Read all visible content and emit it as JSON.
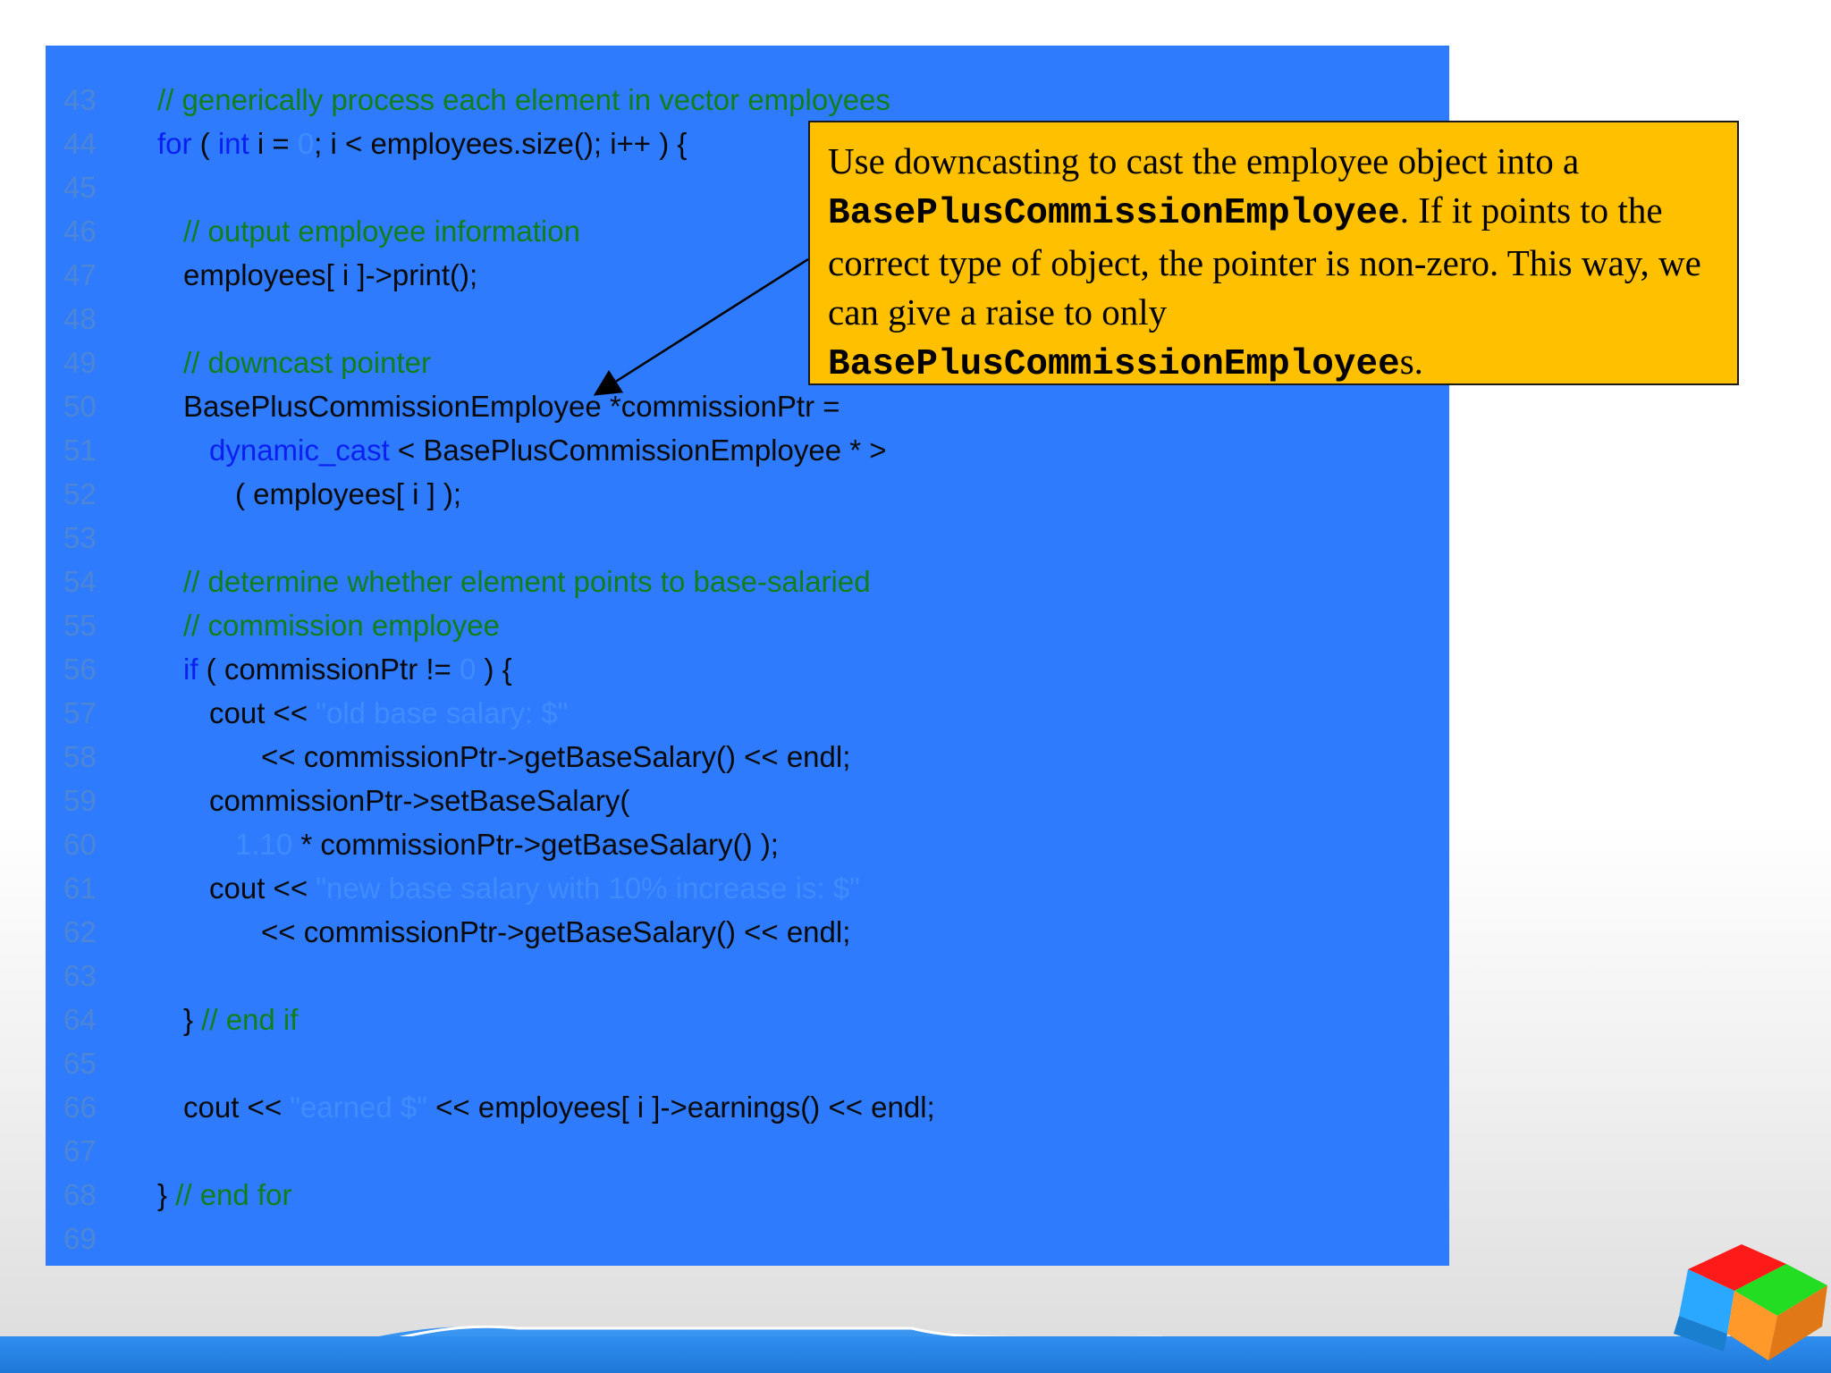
{
  "code": {
    "lines": [
      {
        "n": "43",
        "indent": 0,
        "parts": [
          {
            "t": "// generically process each element in vector employees",
            "c": "cm"
          }
        ]
      },
      {
        "n": "44",
        "indent": 0,
        "parts": [
          {
            "t": "for",
            "c": "kw"
          },
          {
            "t": " ( ",
            "c": ""
          },
          {
            "t": "int",
            "c": "kw"
          },
          {
            "t": " i = ",
            "c": ""
          },
          {
            "t": "0",
            "c": "lit"
          },
          {
            "t": "; i < employees.size(); i++ ) {",
            "c": ""
          }
        ]
      },
      {
        "n": "45",
        "indent": 0,
        "parts": []
      },
      {
        "n": "46",
        "indent": 1,
        "parts": [
          {
            "t": "// output employee information",
            "c": "cm"
          }
        ]
      },
      {
        "n": "47",
        "indent": 1,
        "parts": [
          {
            "t": "employees[ i ]->print();",
            "c": ""
          }
        ]
      },
      {
        "n": "48",
        "indent": 0,
        "parts": []
      },
      {
        "n": "49",
        "indent": 1,
        "parts": [
          {
            "t": "// downcast pointer",
            "c": "cm"
          }
        ]
      },
      {
        "n": "50",
        "indent": 1,
        "parts": [
          {
            "t": "BasePlusCommissionEmployee *commissionPtr =",
            "c": ""
          }
        ]
      },
      {
        "n": "51",
        "indent": 2,
        "parts": [
          {
            "t": "dynamic_cast",
            "c": "kw"
          },
          {
            "t": " < BasePlusCommissionEmployee * >",
            "c": ""
          }
        ]
      },
      {
        "n": "52",
        "indent": 3,
        "parts": [
          {
            "t": "( employees[ i ] );",
            "c": ""
          }
        ]
      },
      {
        "n": "53",
        "indent": 0,
        "parts": []
      },
      {
        "n": "54",
        "indent": 1,
        "parts": [
          {
            "t": "// determine whether element points to base-salaried",
            "c": "cm"
          }
        ]
      },
      {
        "n": "55",
        "indent": 1,
        "parts": [
          {
            "t": "// commission employee",
            "c": "cm"
          }
        ]
      },
      {
        "n": "56",
        "indent": 1,
        "parts": [
          {
            "t": "if",
            "c": "kw"
          },
          {
            "t": " ( commissionPtr != ",
            "c": ""
          },
          {
            "t": "0",
            "c": "lit"
          },
          {
            "t": " ) {",
            "c": ""
          }
        ]
      },
      {
        "n": "57",
        "indent": 2,
        "parts": [
          {
            "t": "cout << ",
            "c": ""
          },
          {
            "t": "\"old base salary: $\"",
            "c": "lit"
          }
        ]
      },
      {
        "n": "58",
        "indent": 4,
        "parts": [
          {
            "t": "<< commissionPtr->getBaseSalary() << endl;",
            "c": ""
          }
        ]
      },
      {
        "n": "59",
        "indent": 2,
        "parts": [
          {
            "t": "commissionPtr->setBaseSalary(",
            "c": ""
          }
        ]
      },
      {
        "n": "60",
        "indent": 3,
        "parts": [
          {
            "t": "1.10",
            "c": "lit"
          },
          {
            "t": " * commissionPtr->getBaseSalary() );",
            "c": ""
          }
        ]
      },
      {
        "n": "61",
        "indent": 2,
        "parts": [
          {
            "t": "cout << ",
            "c": ""
          },
          {
            "t": "\"new base salary with 10% increase is: $\"",
            "c": "lit"
          }
        ]
      },
      {
        "n": "62",
        "indent": 4,
        "parts": [
          {
            "t": "<< commissionPtr->getBaseSalary() << endl;",
            "c": ""
          }
        ]
      },
      {
        "n": "63",
        "indent": 0,
        "parts": []
      },
      {
        "n": "64",
        "indent": 1,
        "parts": [
          {
            "t": "} ",
            "c": ""
          },
          {
            "t": "// end if",
            "c": "cm"
          }
        ]
      },
      {
        "n": "65",
        "indent": 0,
        "parts": []
      },
      {
        "n": "66",
        "indent": 1,
        "parts": [
          {
            "t": "cout << ",
            "c": ""
          },
          {
            "t": "\"earned $\"",
            "c": "lit"
          },
          {
            "t": " << employees[ i ]->earnings() << endl;",
            "c": ""
          }
        ]
      },
      {
        "n": "67",
        "indent": 0,
        "parts": []
      },
      {
        "n": "68",
        "indent": 0,
        "parts": [
          {
            "t": "} ",
            "c": ""
          },
          {
            "t": "// end for",
            "c": "cm"
          }
        ]
      },
      {
        "n": "69",
        "indent": 0,
        "parts": []
      }
    ]
  },
  "callout": {
    "parts": [
      {
        "t": "Use downcasting to cast the employee object into a ",
        "mono": false
      },
      {
        "t": "BasePlusCommissionEmployee",
        "mono": true
      },
      {
        "t": ". If it points to the correct type of object, the pointer is non-zero. This way, we can give a raise to only ",
        "mono": false
      },
      {
        "t": "BasePlusCommissionEmployee",
        "mono": true
      },
      {
        "t": "s.",
        "mono": false
      }
    ]
  },
  "colors": {
    "panel": "#2e7bfd",
    "callout": "#ffc000",
    "keyword": "#0a1ff0",
    "comment": "#0f7f1a",
    "literal": "#3f8cff"
  }
}
